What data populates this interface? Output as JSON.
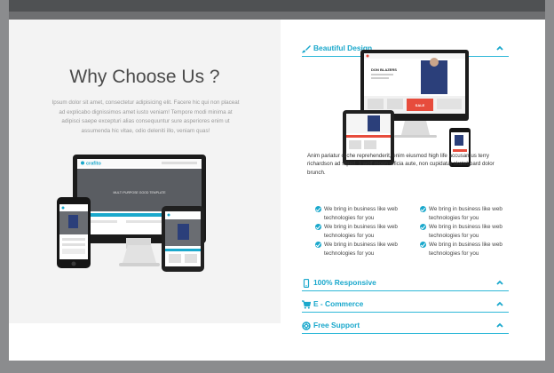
{
  "colors": {
    "accent": "#1aa8cc",
    "panel_bg": "#f3f3f3",
    "frame": "#6e6f71"
  },
  "left": {
    "title": "Why Choose Us ?",
    "intro": "Ipsum dolor sit amet, consectetur adipisicing elit. Facere hic qui non placeat ad explicabo dignissimos amet iusto veniam! Tempore modi minima at adipisci saepe excepturi alias consequuntur sure asperiores enim ut assumenda hic vitae, odio deleniti illo, veniam quas!",
    "mockup_brand": "crafito",
    "mockup_caption": "MULTI PURPOSE GOOD TEMPLATE"
  },
  "accordion": [
    {
      "label": "Beautiful Design",
      "icon": "brush-icon",
      "expanded": true
    },
    {
      "label": "100% Responsive",
      "icon": "mobile-icon",
      "expanded": false
    },
    {
      "label": "E - Commerce",
      "icon": "cart-icon",
      "expanded": false
    },
    {
      "label": "Free Support",
      "icon": "lifebuoy-icon",
      "expanded": false
    }
  ],
  "right": {
    "mockup_heading": "DON BLAZERS",
    "mockup_badge": "SALE",
    "description": "Anim pariatur cliche reprehenderit, enim eiusmod high life accusamus terry richardson ad squid. 3 wolf moon officia aute, non cupidatat skateboard dolor brunch.",
    "features": [
      "We bring in business like web technologies for you",
      "We bring in business like web technologies for you",
      "We bring in business like web technologies for you",
      "We bring in business like web technologies for you",
      "We bring in business like web technologies for you",
      "We bring in business like web technologies for you"
    ]
  }
}
